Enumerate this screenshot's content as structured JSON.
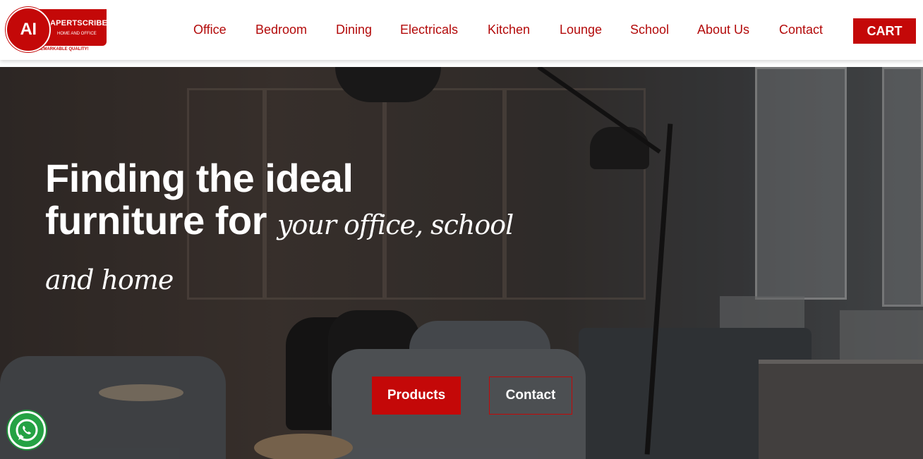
{
  "logo": {
    "initials": "AI",
    "name": "APERTSCRIBE",
    "sub": "HOME AND OFFICE",
    "tagline": "REMARKABLE QUALITY!"
  },
  "nav": {
    "items": [
      "Office",
      "Bedroom",
      "Dining",
      "Electricals",
      "Kitchen",
      "Lounge",
      "School",
      "About Us",
      "Contact"
    ],
    "cart": "CART"
  },
  "hero": {
    "line1": "Finding the ideal",
    "line2": "furniture for",
    "script1": "your office, school",
    "script2": "and home",
    "primary_button": "Products",
    "secondary_button": "Contact"
  },
  "colors": {
    "brand": "#c40808",
    "nav_text": "#b30a0a",
    "whatsapp": "#25a244"
  },
  "icons": {
    "whatsapp": "whatsapp-icon"
  }
}
